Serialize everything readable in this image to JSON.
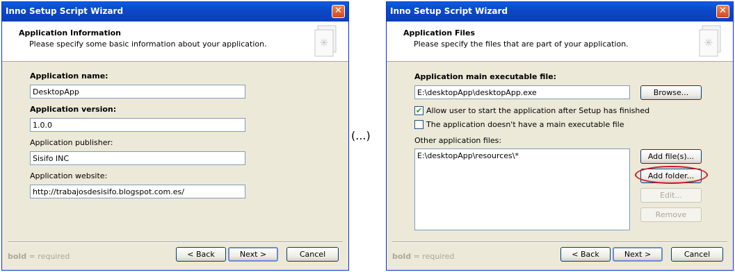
{
  "left_window": {
    "title": "Inno Setup Script Wizard",
    "header_title": "Application Information",
    "header_desc": "Please specify some basic information about your application.",
    "fields": {
      "app_name_label": "Application name:",
      "app_name_value": "DesktopApp",
      "app_version_label": "Application version:",
      "app_version_value": "1.0.0",
      "publisher_label": "Application publisher:",
      "publisher_value": "Sisifo INC",
      "website_label": "Application website:",
      "website_value": "http://trabajosdesisifo.blogspot.com.es/"
    },
    "footer": {
      "bold": "bold",
      "required": " = required"
    },
    "buttons": {
      "back": "< Back",
      "next": "Next >",
      "cancel": "Cancel"
    }
  },
  "separator_text": "(...)",
  "right_window": {
    "title": "Inno Setup Script Wizard",
    "header_title": "Application Files",
    "header_desc": "Please specify the files that are part of your application.",
    "main_exe_label": "Application main executable file:",
    "main_exe_value": "E:\\desktopApp\\desktopApp.exe",
    "browse": "Browse...",
    "checkbox_allow": {
      "label": "Allow user to start the application after Setup has finished",
      "checked": true
    },
    "checkbox_noexe": {
      "label": "The application doesn't have a main executable file",
      "checked": false
    },
    "other_files_label": "Other application files:",
    "other_files": [
      "E:\\desktopApp\\resources\\*"
    ],
    "add_files": "Add file(s)...",
    "add_folder": "Add folder...",
    "edit": "Edit...",
    "remove": "Remove",
    "footer": {
      "bold": "bold",
      "required": " = required"
    },
    "buttons": {
      "back": "< Back",
      "next": "Next >",
      "cancel": "Cancel"
    }
  },
  "colors": {
    "titlebar": "#0a49c8",
    "highlight_oval": "#d8141b",
    "body": "#ece9d8"
  },
  "icons": [
    "close-icon",
    "wizard-document-icon",
    "checkbox-checked-icon"
  ]
}
